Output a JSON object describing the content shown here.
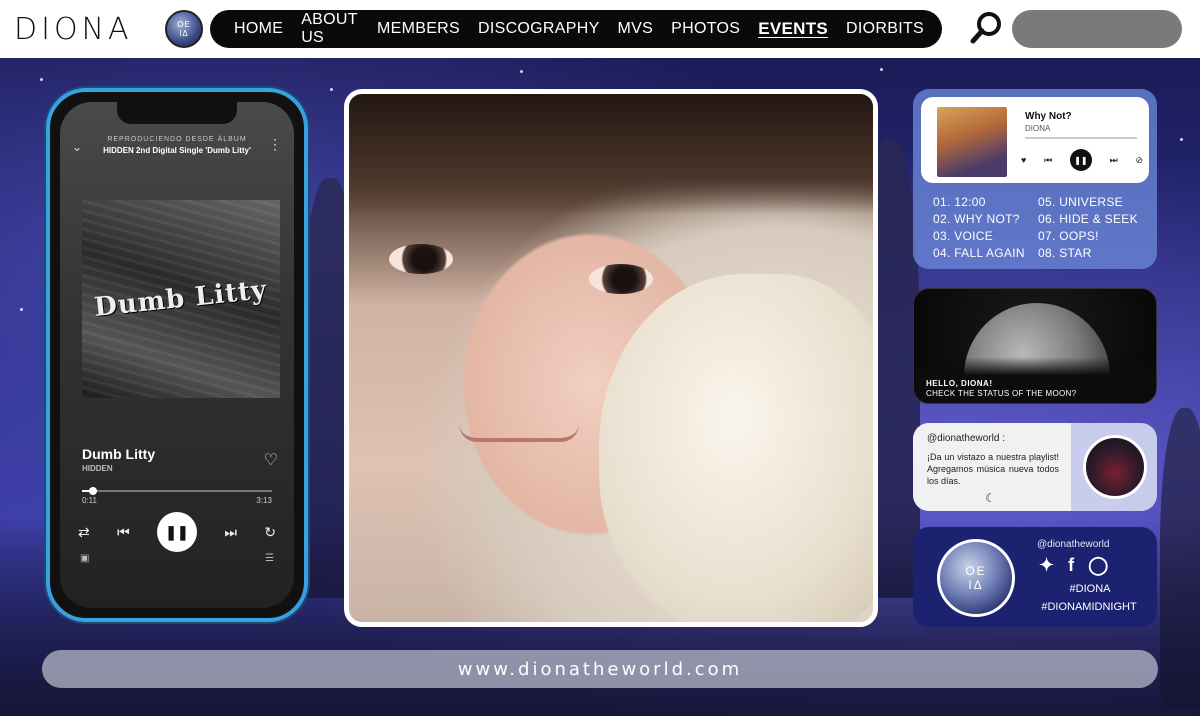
{
  "brand": {
    "logo_text": "DIONA",
    "badge_text": "OE\nΙΔ"
  },
  "nav": {
    "items": [
      {
        "label": "HOME",
        "active": false
      },
      {
        "label": "ABOUT US",
        "active": false
      },
      {
        "label": "MEMBERS",
        "active": false
      },
      {
        "label": "DISCOGRAPHY",
        "active": false
      },
      {
        "label": "MVS",
        "active": false
      },
      {
        "label": "PHOTOS",
        "active": false
      },
      {
        "label": "EVENTS",
        "active": true
      },
      {
        "label": "DIORBITS",
        "active": false
      }
    ]
  },
  "search": {
    "value": "",
    "placeholder": ""
  },
  "phone_player": {
    "context_line": "REPRODUCIENDO DESDE ÁLBUM",
    "album_line": "HIDDEN  2nd Digital Single 'Dumb Litty'",
    "cover_text": "Dumb Litty",
    "track_title": "Dumb Litty",
    "artist": "HIDDEN",
    "elapsed": "0:11",
    "duration": "3:13",
    "progress": 0.06
  },
  "mini_player": {
    "title": "Why Not?",
    "artist": "DIONA",
    "progress": 0.0
  },
  "tracklist": [
    "01. 12:00",
    "02. WHY NOT?",
    "03. VOICE",
    "04. FALL AGAIN",
    "05. UNIVERSE",
    "06. HIDE & SEEK",
    "07. OOPS!",
    "08. STAR"
  ],
  "moon_panel": {
    "line1": "HELLO, DIONA!",
    "line2": "CHECK THE STATUS OF THE MOON?"
  },
  "insta_panel": {
    "handle": "@dionatheworld :",
    "text": "¡Da un vistazo a nuestra playlist! Agregamos música nueva todos los días."
  },
  "social_panel": {
    "handle": "@dionatheworld",
    "hashtag1": "#DIONA",
    "hashtag2": "#DIONAMIDNIGHT",
    "badge_text": "OE\nΙΔ"
  },
  "footer": {
    "url": "www.dionatheworld.com"
  },
  "colors": {
    "nav_bg": "#0a0a0a",
    "phone_frame": "#3aa0e0",
    "music_panel": "#6e8cdc",
    "social_panel": "#1b2270",
    "search_box": "#7a7a7a"
  }
}
